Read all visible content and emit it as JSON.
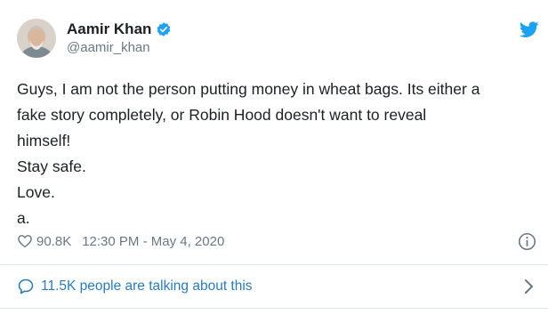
{
  "author": {
    "name": "Aamir Khan",
    "handle": "@aamir_khan"
  },
  "tweet": {
    "lines": [
      "Guys, I am not the person putting money in wheat bags. Its either a",
      "fake story completely, or Robin Hood doesn't want to reveal",
      "himself!",
      "Stay safe.",
      "Love.",
      "a."
    ]
  },
  "meta": {
    "likes": "90.8K",
    "timestamp": "12:30 PM - May 4, 2020"
  },
  "conversation": {
    "label": "11.5K people are talking about this"
  },
  "colors": {
    "accent": "#1da1f2",
    "link": "#2b7bb9",
    "muted": "#697882",
    "divider": "#e1e8ed"
  },
  "icons": [
    "verified-badge-icon",
    "twitter-bird-icon",
    "heart-icon",
    "info-icon",
    "chat-bubble-icon",
    "chevron-right-icon"
  ]
}
